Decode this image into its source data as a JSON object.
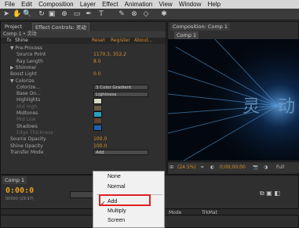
{
  "menubar": [
    "File",
    "Edit",
    "Composition",
    "Layer",
    "Effect",
    "Animation",
    "View",
    "Window",
    "Help"
  ],
  "effect_panel": {
    "tabs": [
      "Project",
      "Effect Controls: 灵动"
    ],
    "comp_path": "Comp 1 • 灵动",
    "header": {
      "effect": "Shine",
      "reset": "Reset",
      "register": "Register",
      "about": "About..."
    },
    "rows": [
      {
        "name": "▼ Pre-Process",
        "indent": 1
      },
      {
        "name": "Source Point",
        "indent": 2,
        "value": "1170.3, 352.2"
      },
      {
        "name": "Ray Length",
        "indent": 2,
        "value": "8.0"
      },
      {
        "name": "▶ Shimmer",
        "indent": 1
      },
      {
        "name": "Boost Light",
        "indent": 1,
        "value": "0.0"
      },
      {
        "name": "▼ Colorize",
        "indent": 1
      },
      {
        "name": "Colorize...",
        "indent": 2,
        "dropdown": "3 Color Gradient"
      },
      {
        "name": "Base On...",
        "indent": 2,
        "dropdown": "Lightness"
      },
      {
        "name": "Highlights",
        "indent": 2,
        "swatch": "#d8d8c8"
      },
      {
        "name": "Mid High",
        "indent": 2,
        "swatch": "#c8b060",
        "dim": true
      },
      {
        "name": "Midtones",
        "indent": 2,
        "swatch": "#2a9fc0"
      },
      {
        "name": "Mid Low",
        "indent": 2,
        "swatch": "#c06a30",
        "dim": true
      },
      {
        "name": "Shadows",
        "indent": 2,
        "swatch": "#1f5fb0"
      },
      {
        "name": "Edge Thickness",
        "indent": 2,
        "dim": true
      },
      {
        "name": "Source Opacity",
        "indent": 1,
        "value": "100.0"
      },
      {
        "name": "Shine Opacity",
        "indent": 1,
        "value": "100.0"
      },
      {
        "name": "Transfer Mode",
        "indent": 1,
        "dropdown": "Add"
      }
    ]
  },
  "composition": {
    "tab": "Composition: Comp 1",
    "sub_tab": "Comp 1",
    "zoom": "(24.5%)",
    "timecode": "0;00;00;00"
  },
  "timeline": {
    "tab": "Comp 1",
    "timecode": "0:00:0",
    "frame": "00000 (29.97)",
    "mode_col": "Mode",
    "trkmat_col": "TrkMat"
  },
  "blend_menu": {
    "items": [
      "None",
      "Normal",
      "Add",
      "Multiply",
      "Screen"
    ],
    "highlighted": "Add"
  }
}
